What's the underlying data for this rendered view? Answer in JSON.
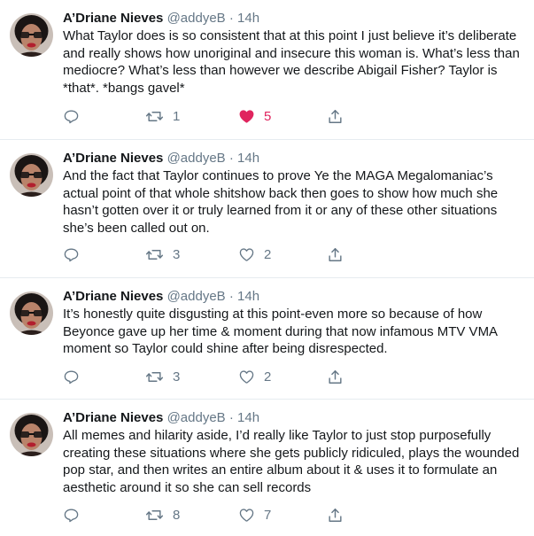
{
  "colors": {
    "text": "#14171a",
    "secondary": "#657786",
    "like_active": "#e0245e",
    "divider": "#e6ecf0"
  },
  "tweets": [
    {
      "author": "A’Driane Nieves",
      "handle": "@addyeB",
      "separator": "·",
      "time": "14h",
      "text": "What Taylor does is so consistent that at this point I just believe it’s deliberate  and really shows how unoriginal and insecure this woman is. What’s less than mediocre? What’s less than however we describe Abigail Fisher? Taylor is *that*. *bangs gavel*",
      "reply_count": "",
      "retweet_count": "1",
      "like_count": "5",
      "liked": true,
      "icons": [
        "reply-icon",
        "retweet-icon",
        "heart-filled-icon",
        "share-icon"
      ]
    },
    {
      "author": "A’Driane Nieves",
      "handle": "@addyeB",
      "separator": "·",
      "time": "14h",
      "text": "And the fact that Taylor continues to prove Ye the MAGA Megalomaniac’s actual point of that whole shitshow back then goes to show how much she hasn’t gotten over it or truly learned from it or any of these other situations she’s been called out on.",
      "reply_count": "",
      "retweet_count": "3",
      "like_count": "2",
      "liked": false,
      "icons": [
        "reply-icon",
        "retweet-icon",
        "heart-icon",
        "share-icon"
      ]
    },
    {
      "author": "A’Driane Nieves",
      "handle": "@addyeB",
      "separator": "·",
      "time": "14h",
      "text": "It’s honestly quite disgusting at this point-even more so because of how Beyonce gave up her time & moment during that now infamous MTV VMA moment so Taylor could shine after being disrespected.",
      "reply_count": "",
      "retweet_count": "3",
      "like_count": "2",
      "liked": false,
      "icons": [
        "reply-icon",
        "retweet-icon",
        "heart-icon",
        "share-icon"
      ]
    },
    {
      "author": "A’Driane Nieves",
      "handle": "@addyeB",
      "separator": "·",
      "time": "14h",
      "text": "All memes and hilarity aside, I’d really like Taylor to just stop purposefully creating these situations where she gets publicly ridiculed, plays the wounded pop star, and then writes an entire album about it & uses it to formulate an aesthetic around it so she can sell records",
      "reply_count": "",
      "retweet_count": "8",
      "like_count": "7",
      "liked": false,
      "icons": [
        "reply-icon",
        "retweet-icon",
        "heart-icon",
        "share-icon"
      ]
    }
  ]
}
